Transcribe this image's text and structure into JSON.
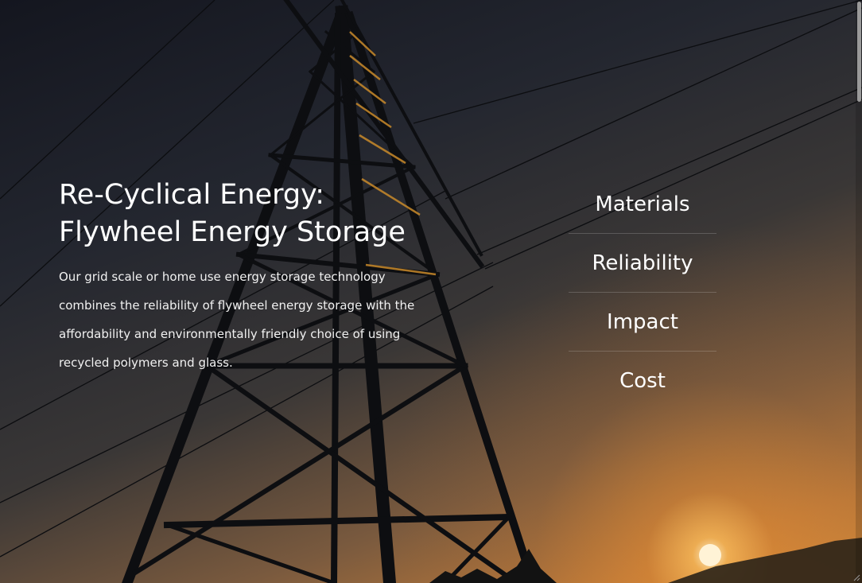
{
  "hero": {
    "title_line1": "Re-Cyclical Energy:",
    "title_line2": "Flywheel Energy Storage",
    "description": "Our grid scale or home use energy storage technology combines the reliability of flywheel energy storage with the affordability and environmentally friendly choice of using recycled polymers and glass."
  },
  "nav": {
    "items": [
      {
        "label": "Materials"
      },
      {
        "label": "Reliability"
      },
      {
        "label": "Impact"
      },
      {
        "label": "Cost"
      }
    ]
  },
  "background": {
    "scene": "transmission-tower-at-sunset",
    "sky_top_color": "#14161f",
    "sky_horizon_color": "#d28a3a",
    "sun_color": "#fff0c8",
    "tower_color": "#0e0f12",
    "accent_color": "#c98a2a"
  },
  "icons": {
    "scrollbar": "scrollbar-thumb",
    "resize": "resize-grip-icon"
  }
}
